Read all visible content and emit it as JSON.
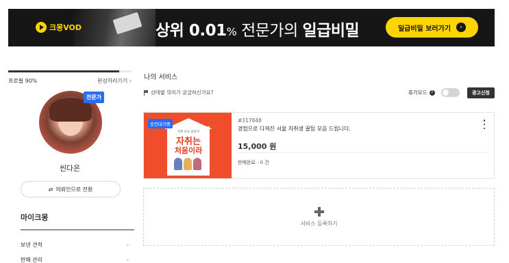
{
  "banner": {
    "vod_label": "크몽VOD",
    "headline_part1": "상위 ",
    "headline_number": "0.01",
    "headline_pct": "%",
    "headline_part2": " 전문가의 ",
    "headline_part3": "일급비밀",
    "cta_label": "일급비밀 보러가기",
    "cta_arrow": "›"
  },
  "sidebar": {
    "profile_label": "프로필 90%",
    "profile_progress": 0.9,
    "complete_link": "완성하러가기 ›",
    "expert_badge": "전문가",
    "username": "씬다온",
    "switch_icon": "⇄",
    "switch_label": "의뢰인으로 전환",
    "menu_title": "마이크몽",
    "menu_items": [
      {
        "label": "보낸 견적",
        "chevron": "⌄"
      },
      {
        "label": "판매 관리",
        "chevron": "⌄"
      }
    ]
  },
  "main": {
    "title": "나의 서비스",
    "status_question": "상태별 의미가 궁금하신가요?",
    "vacation_label": "휴가모드",
    "help_glyph": "?",
    "ad_button": "광고신청",
    "service": {
      "badge": "승인대기중",
      "thumb_small": "자취 초보 입문서",
      "thumb_big1": "자취는",
      "thumb_big2": "처음이라",
      "id": "#317848",
      "title": "경험으로 다져진 서울 자취생 꿀팁 모음 드립니다.",
      "price": "15,000 원",
      "sales": "판매완료 : 0 건"
    },
    "register_label": "서비스 등록하기"
  },
  "colors": {
    "brand_yellow": "#ffd400",
    "expert_blue": "#2a6df5",
    "thumb_red": "#f04d2d"
  }
}
